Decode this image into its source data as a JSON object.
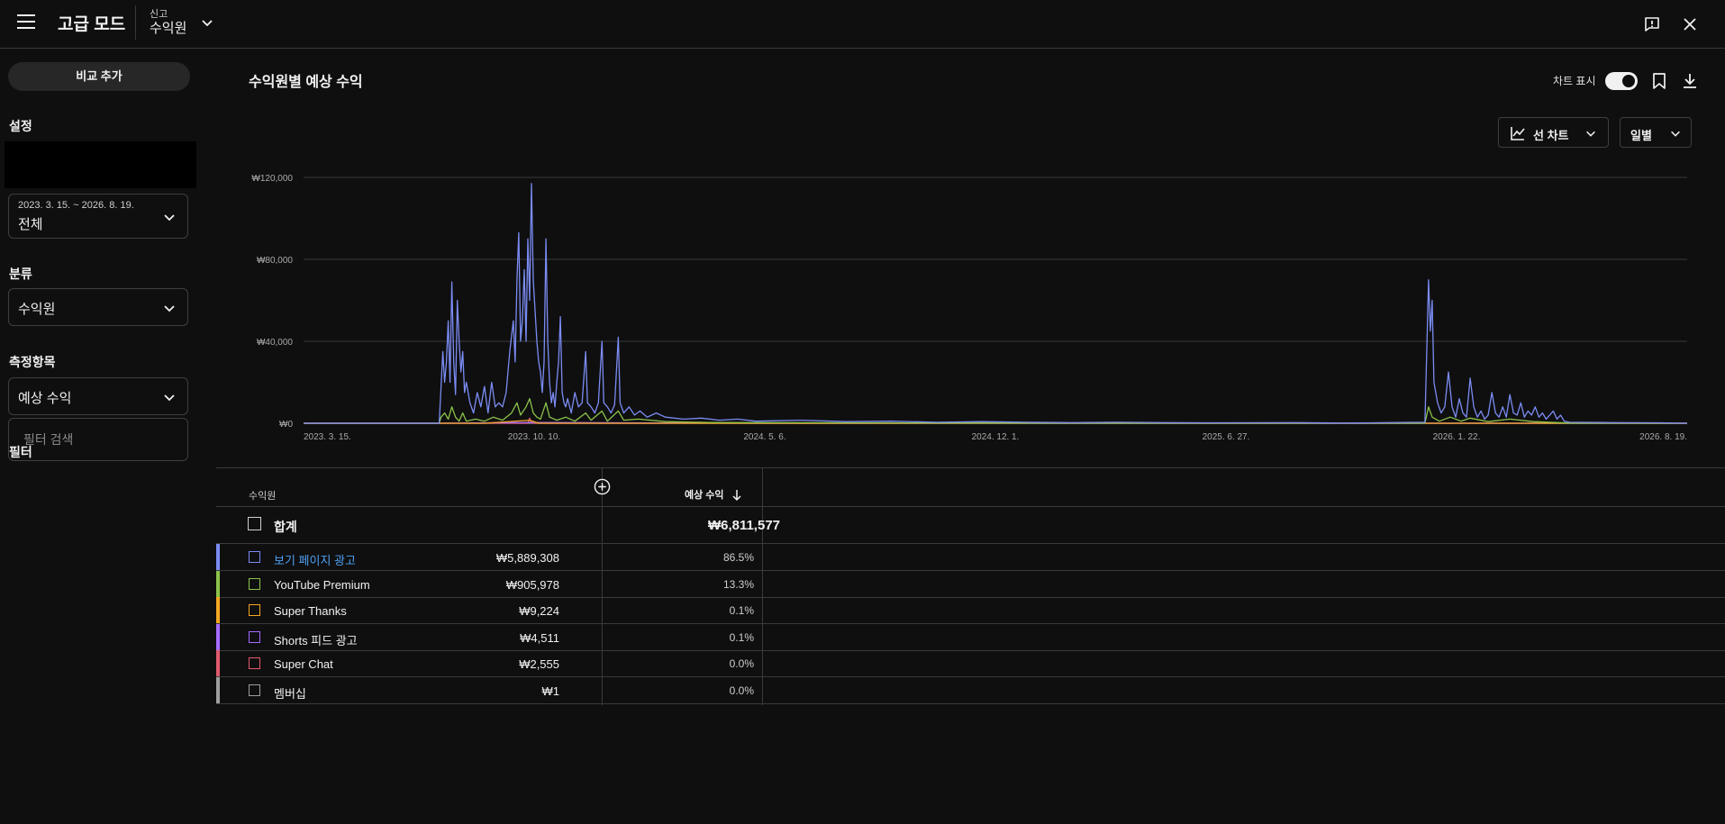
{
  "header": {
    "mode_title": "고급 모드",
    "context_small": "신고",
    "context_main": "수익원"
  },
  "sidebar": {
    "compare_button": "비교 추가",
    "settings_label": "설정",
    "date_range_small": "2023. 3. 15. ~ 2026. 8. 19.",
    "date_range_main": "전체",
    "category_label": "분류",
    "category_value": "수익원",
    "metric_label": "측정항목",
    "metric_value": "예상 수익",
    "filter_label": "필터",
    "filter_placeholder": "필터 검색"
  },
  "main": {
    "title": "수익원별 예상 수익",
    "chart_toggle_label": "차트 표시",
    "chart_type_button": "선 차트",
    "interval_button": "일별"
  },
  "chart_data": {
    "type": "line",
    "x_tick_labels": [
      "2023. 3. 15.",
      "2023. 10. 10.",
      "2024. 5. 6.",
      "2024. 12. 1.",
      "2025. 6. 27.",
      "2026. 1. 22.",
      "2026. 8. 19."
    ],
    "y_tick_labels": [
      "₩120,000",
      "₩80,000",
      "₩40,000",
      "₩0"
    ],
    "ylim": [
      0,
      120000
    ],
    "grid": true,
    "series": [
      {
        "name": "보기 페이지 광고",
        "color": "#7b8cf4",
        "points": [
          [
            0,
            0
          ],
          [
            100,
            0
          ],
          [
            150,
            0
          ],
          [
            154,
            35000
          ],
          [
            156,
            20000
          ],
          [
            158,
            30000
          ],
          [
            160,
            50000
          ],
          [
            162,
            20000
          ],
          [
            164,
            69000
          ],
          [
            166,
            30000
          ],
          [
            168,
            14000
          ],
          [
            170,
            60000
          ],
          [
            172,
            40000
          ],
          [
            174,
            25000
          ],
          [
            176,
            35000
          ],
          [
            178,
            15000
          ],
          [
            180,
            20000
          ],
          [
            184,
            10000
          ],
          [
            188,
            5000
          ],
          [
            192,
            15000
          ],
          [
            196,
            8000
          ],
          [
            200,
            18000
          ],
          [
            204,
            5000
          ],
          [
            208,
            20000
          ],
          [
            212,
            8000
          ],
          [
            216,
            10000
          ],
          [
            220,
            8000
          ],
          [
            224,
            15000
          ],
          [
            228,
            35000
          ],
          [
            232,
            50000
          ],
          [
            234,
            30000
          ],
          [
            236,
            70000
          ],
          [
            238,
            93000
          ],
          [
            240,
            40000
          ],
          [
            242,
            50000
          ],
          [
            244,
            75000
          ],
          [
            246,
            40000
          ],
          [
            248,
            90000
          ],
          [
            250,
            60000
          ],
          [
            252,
            117000
          ],
          [
            254,
            70000
          ],
          [
            256,
            55000
          ],
          [
            258,
            40000
          ],
          [
            260,
            30000
          ],
          [
            262,
            25000
          ],
          [
            264,
            15000
          ],
          [
            266,
            30000
          ],
          [
            268,
            90000
          ],
          [
            270,
            40000
          ],
          [
            272,
            20000
          ],
          [
            274,
            10000
          ],
          [
            276,
            15000
          ],
          [
            278,
            8000
          ],
          [
            280,
            20000
          ],
          [
            282,
            30000
          ],
          [
            284,
            52000
          ],
          [
            286,
            15000
          ],
          [
            288,
            10000
          ],
          [
            290,
            8000
          ],
          [
            292,
            12000
          ],
          [
            296,
            5000
          ],
          [
            300,
            15000
          ],
          [
            304,
            8000
          ],
          [
            308,
            10000
          ],
          [
            312,
            35000
          ],
          [
            314,
            10000
          ],
          [
            318,
            8000
          ],
          [
            322,
            5000
          ],
          [
            326,
            10000
          ],
          [
            330,
            40000
          ],
          [
            332,
            10000
          ],
          [
            336,
            8000
          ],
          [
            340,
            5000
          ],
          [
            344,
            9000
          ],
          [
            348,
            42000
          ],
          [
            350,
            10000
          ],
          [
            354,
            5000
          ],
          [
            360,
            8000
          ],
          [
            366,
            4000
          ],
          [
            372,
            6000
          ],
          [
            380,
            3000
          ],
          [
            390,
            5000
          ],
          [
            400,
            3000
          ],
          [
            420,
            2000
          ],
          [
            440,
            2500
          ],
          [
            460,
            1500
          ],
          [
            480,
            2000
          ],
          [
            500,
            1000
          ],
          [
            550,
            1500
          ],
          [
            600,
            800
          ],
          [
            650,
            1000
          ],
          [
            700,
            500
          ],
          [
            750,
            800
          ],
          [
            800,
            500
          ],
          [
            850,
            300
          ],
          [
            900,
            500
          ],
          [
            950,
            300
          ],
          [
            1000,
            200
          ],
          [
            1100,
            300
          ],
          [
            1150,
            100
          ],
          [
            1200,
            300
          ],
          [
            1240,
            500
          ],
          [
            1244,
            70000
          ],
          [
            1246,
            45000
          ],
          [
            1248,
            60000
          ],
          [
            1250,
            20000
          ],
          [
            1254,
            10000
          ],
          [
            1258,
            5000
          ],
          [
            1262,
            8000
          ],
          [
            1266,
            25000
          ],
          [
            1270,
            8000
          ],
          [
            1274,
            3000
          ],
          [
            1278,
            12000
          ],
          [
            1282,
            5000
          ],
          [
            1286,
            3000
          ],
          [
            1290,
            22000
          ],
          [
            1294,
            8000
          ],
          [
            1298,
            3000
          ],
          [
            1302,
            6000
          ],
          [
            1306,
            2000
          ],
          [
            1310,
            4000
          ],
          [
            1314,
            15000
          ],
          [
            1318,
            5000
          ],
          [
            1322,
            3000
          ],
          [
            1326,
            8000
          ],
          [
            1330,
            3000
          ],
          [
            1334,
            14000
          ],
          [
            1338,
            5000
          ],
          [
            1342,
            4000
          ],
          [
            1346,
            10000
          ],
          [
            1350,
            3000
          ],
          [
            1354,
            6000
          ],
          [
            1358,
            4000
          ],
          [
            1362,
            8000
          ],
          [
            1366,
            3000
          ],
          [
            1370,
            5000
          ],
          [
            1374,
            2000
          ],
          [
            1378,
            4000
          ],
          [
            1382,
            6000
          ],
          [
            1386,
            2000
          ],
          [
            1390,
            4000
          ],
          [
            1394,
            1000
          ],
          [
            1400,
            500
          ],
          [
            1450,
            300
          ],
          [
            1500,
            200
          ],
          [
            1530,
            0
          ]
        ]
      },
      {
        "name": "YouTube Premium",
        "color": "#8bc34a",
        "points": [
          [
            0,
            0
          ],
          [
            150,
            0
          ],
          [
            152,
            3000
          ],
          [
            156,
            5000
          ],
          [
            160,
            2000
          ],
          [
            164,
            8000
          ],
          [
            168,
            3000
          ],
          [
            172,
            1000
          ],
          [
            176,
            5000
          ],
          [
            180,
            1000
          ],
          [
            190,
            2000
          ],
          [
            200,
            1000
          ],
          [
            210,
            3000
          ],
          [
            220,
            1500
          ],
          [
            230,
            5000
          ],
          [
            236,
            10000
          ],
          [
            240,
            4000
          ],
          [
            246,
            8000
          ],
          [
            250,
            12000
          ],
          [
            254,
            5000
          ],
          [
            258,
            3000
          ],
          [
            262,
            2000
          ],
          [
            268,
            10000
          ],
          [
            272,
            3000
          ],
          [
            280,
            1500
          ],
          [
            290,
            3000
          ],
          [
            300,
            1000
          ],
          [
            312,
            5000
          ],
          [
            318,
            1500
          ],
          [
            330,
            6000
          ],
          [
            336,
            1000
          ],
          [
            348,
            6000
          ],
          [
            354,
            1500
          ],
          [
            370,
            2000
          ],
          [
            400,
            800
          ],
          [
            450,
            400
          ],
          [
            500,
            300
          ],
          [
            600,
            200
          ],
          [
            800,
            100
          ],
          [
            1000,
            50
          ],
          [
            1240,
            100
          ],
          [
            1244,
            8000
          ],
          [
            1248,
            3000
          ],
          [
            1256,
            1000
          ],
          [
            1268,
            3000
          ],
          [
            1280,
            1000
          ],
          [
            1290,
            2500
          ],
          [
            1310,
            800
          ],
          [
            1334,
            2000
          ],
          [
            1360,
            800
          ],
          [
            1400,
            100
          ],
          [
            1530,
            0
          ]
        ]
      },
      {
        "name": "Super Thanks",
        "color": "#f5a623",
        "points": [
          [
            0,
            0
          ],
          [
            200,
            0
          ],
          [
            250,
            1500
          ],
          [
            260,
            0
          ],
          [
            1530,
            0
          ]
        ]
      },
      {
        "name": "Shorts 피드 광고",
        "color": "#a66bff",
        "points": [
          [
            0,
            0
          ],
          [
            150,
            0
          ],
          [
            250,
            400
          ],
          [
            350,
            200
          ],
          [
            500,
            0
          ],
          [
            1530,
            0
          ]
        ]
      },
      {
        "name": "Super Chat",
        "color": "#e05a6d",
        "points": [
          [
            0,
            0
          ],
          [
            248,
            0
          ],
          [
            250,
            2500
          ],
          [
            252,
            0
          ],
          [
            1530,
            0
          ]
        ]
      },
      {
        "name": "멤버십",
        "color": "#9e9e9e",
        "points": [
          [
            0,
            0
          ],
          [
            1530,
            0
          ]
        ]
      }
    ]
  },
  "table": {
    "col_source": "수익원",
    "col_revenue": "예상 수익",
    "total_label": "합계",
    "total_value": "₩6,811,577",
    "rows": [
      {
        "name": "보기 페이지 광고",
        "value": "₩5,889,308",
        "pct": "86.5%",
        "color": "#7b8cf4",
        "name_color": "#4ea1f5"
      },
      {
        "name": "YouTube Premium",
        "value": "₩905,978",
        "pct": "13.3%",
        "color": "#8bc34a",
        "name_color": "#f1f1f1"
      },
      {
        "name": "Super Thanks",
        "value": "₩9,224",
        "pct": "0.1%",
        "color": "#f5a623",
        "name_color": "#f1f1f1"
      },
      {
        "name": "Shorts 피드 광고",
        "value": "₩4,511",
        "pct": "0.1%",
        "color": "#a66bff",
        "name_color": "#f1f1f1"
      },
      {
        "name": "Super Chat",
        "value": "₩2,555",
        "pct": "0.0%",
        "color": "#e05a6d",
        "name_color": "#f1f1f1"
      },
      {
        "name": "멤버십",
        "value": "₩1",
        "pct": "0.0%",
        "color": "#9e9e9e",
        "name_color": "#f1f1f1"
      }
    ]
  }
}
